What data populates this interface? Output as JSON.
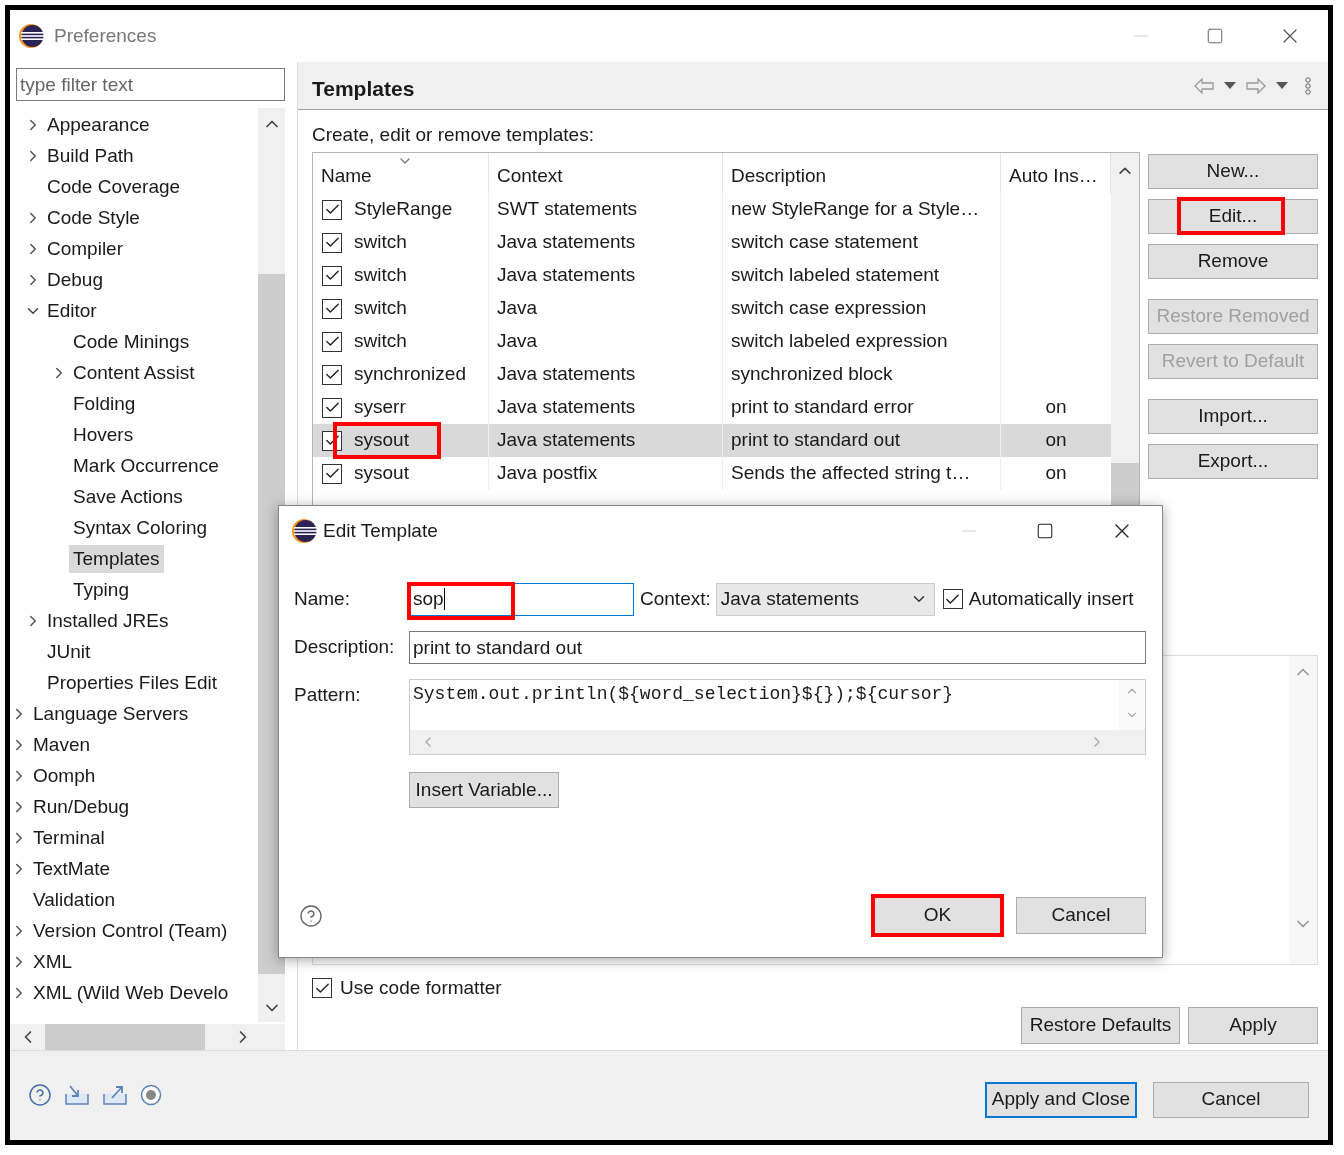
{
  "window": {
    "title": "Preferences"
  },
  "filter": {
    "placeholder": "type filter text"
  },
  "tree": [
    {
      "children": [
        {
          "label": "Appearance",
          "expanded": false,
          "selected": false
        },
        {
          "label": "Build Path",
          "expanded": false,
          "selected": false
        },
        {
          "label": "Code Coverage",
          "selected": false
        },
        {
          "label": "Code Style",
          "expanded": false,
          "selected": false
        },
        {
          "label": "Compiler",
          "expanded": false,
          "selected": false
        },
        {
          "label": "Debug",
          "expanded": false,
          "selected": false
        },
        {
          "label": "Editor",
          "expanded": true,
          "selected": false,
          "children": [
            {
              "label": "Code Minings",
              "selected": false
            },
            {
              "label": "Content Assist",
              "expanded": false,
              "selected": false
            },
            {
              "label": "Folding",
              "selected": false
            },
            {
              "label": "Hovers",
              "selected": false
            },
            {
              "label": "Mark Occurrence",
              "selected": false
            },
            {
              "label": "Save Actions",
              "selected": false
            },
            {
              "label": "Syntax Coloring",
              "selected": false
            },
            {
              "label": "Templates",
              "selected": true
            },
            {
              "label": "Typing",
              "selected": false
            }
          ]
        },
        {
          "label": "Installed JREs",
          "expanded": false,
          "selected": false
        },
        {
          "label": "JUnit",
          "selected": false
        },
        {
          "label": "Properties Files Edit",
          "selected": false
        }
      ]
    },
    {
      "label": "Language Servers",
      "expanded": false,
      "selected": false
    },
    {
      "label": "Maven",
      "expanded": false,
      "selected": false
    },
    {
      "label": "Oomph",
      "expanded": false,
      "selected": false
    },
    {
      "label": "Run/Debug",
      "expanded": false,
      "selected": false
    },
    {
      "label": "Terminal",
      "expanded": false,
      "selected": false
    },
    {
      "label": "TextMate",
      "expanded": false,
      "selected": false
    },
    {
      "label": "Validation",
      "selected": false
    },
    {
      "label": "Version Control (Team)",
      "expanded": false,
      "selected": false
    },
    {
      "label": "XML",
      "expanded": false,
      "selected": false
    },
    {
      "label": "XML (Wild Web Develo",
      "expanded": false,
      "selected": false
    }
  ],
  "page": {
    "title": "Templates",
    "subtitle": "Create, edit or remove templates:"
  },
  "table": {
    "columns": [
      "Name",
      "Context",
      "Description",
      "Auto Ins…"
    ],
    "rows": [
      {
        "name": "StyleRange",
        "context": "SWT statements",
        "description": "new StyleRange for a Style…",
        "auto_insert": "",
        "checked": true,
        "selected": false,
        "highlighted": false
      },
      {
        "name": "switch",
        "context": "Java statements",
        "description": "switch case statement",
        "auto_insert": "",
        "checked": true,
        "selected": false,
        "highlighted": false
      },
      {
        "name": "switch",
        "context": "Java statements",
        "description": "switch labeled statement",
        "auto_insert": "",
        "checked": true,
        "selected": false,
        "highlighted": false
      },
      {
        "name": "switch",
        "context": "Java",
        "description": "switch case expression",
        "auto_insert": "",
        "checked": true,
        "selected": false,
        "highlighted": false
      },
      {
        "name": "switch",
        "context": "Java",
        "description": "switch labeled expression",
        "auto_insert": "",
        "checked": true,
        "selected": false,
        "highlighted": false
      },
      {
        "name": "synchronized",
        "context": "Java statements",
        "description": "synchronized block",
        "auto_insert": "",
        "checked": true,
        "selected": false,
        "highlighted": false
      },
      {
        "name": "syserr",
        "context": "Java statements",
        "description": "print to standard error",
        "auto_insert": "on",
        "checked": true,
        "selected": false,
        "highlighted": false
      },
      {
        "name": "sysout",
        "context": "Java statements",
        "description": "print to standard out",
        "auto_insert": "on",
        "checked": true,
        "selected": true,
        "highlighted": true
      },
      {
        "name": "sysout",
        "context": "Java postfix",
        "description": "Sends the affected string t…",
        "auto_insert": "on",
        "checked": true,
        "selected": false,
        "highlighted": false
      }
    ]
  },
  "side_button_groups": [
    [
      {
        "label": "New...",
        "disabled": false,
        "highlighted": false
      },
      {
        "label": "Edit...",
        "disabled": false,
        "highlighted": true
      },
      {
        "label": "Remove",
        "disabled": false,
        "highlighted": false
      }
    ],
    [
      {
        "label": "Restore Removed",
        "disabled": true,
        "highlighted": false
      },
      {
        "label": "Revert to Default",
        "disabled": true,
        "highlighted": false
      }
    ],
    [
      {
        "label": "Import...",
        "disabled": false,
        "highlighted": false
      },
      {
        "label": "Export...",
        "disabled": false,
        "highlighted": false
      }
    ]
  ],
  "use_code_formatter": {
    "label": "Use code formatter",
    "checked": true
  },
  "page_buttons": [
    "Restore Defaults",
    "Apply"
  ],
  "footer_buttons": [
    {
      "label": "Apply and Close",
      "default": true
    },
    {
      "label": "Cancel",
      "default": false
    }
  ],
  "dialog": {
    "title": "Edit Template",
    "name": {
      "label": "Name:",
      "value": "sop",
      "highlighted": true
    },
    "context": {
      "label": "Context:",
      "value": "Java statements"
    },
    "auto_insert": {
      "label": "Automatically insert",
      "checked": true
    },
    "description": {
      "label": "Description:",
      "value": "print to standard out"
    },
    "pattern": {
      "label": "Pattern:",
      "value": "System.out.println(${word_selection}${});${cursor}"
    },
    "insert_variable": "Insert Variable...",
    "buttons": [
      {
        "label": "OK",
        "highlighted": true
      },
      {
        "label": "Cancel",
        "highlighted": false
      }
    ]
  }
}
